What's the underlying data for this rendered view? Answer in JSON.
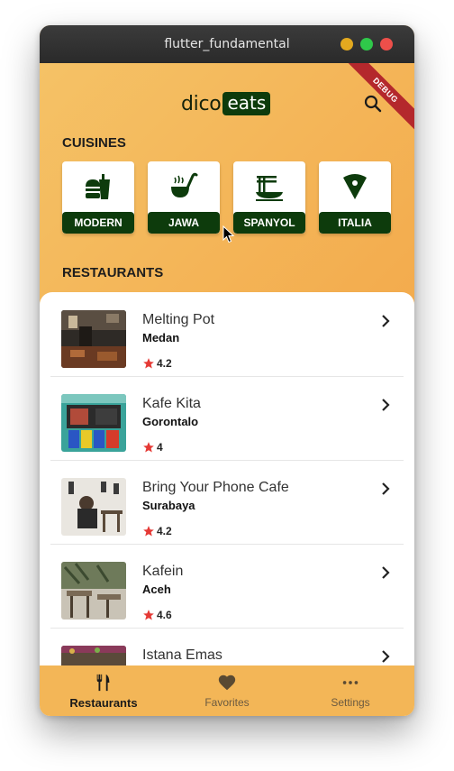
{
  "window": {
    "title": "flutter_fundamental"
  },
  "debug_banner": "DEBUG",
  "logo": {
    "part1": "dico",
    "part2": "eats"
  },
  "sections": {
    "cuisines": "CUISINES",
    "restaurants": "RESTAURANTS"
  },
  "cuisines": [
    {
      "label": "MODERN",
      "icon": "burger-drink-icon"
    },
    {
      "label": "JAWA",
      "icon": "soup-ladle-icon"
    },
    {
      "label": "SPANYOL",
      "icon": "noodle-bowl-icon"
    },
    {
      "label": "ITALIA",
      "icon": "pizza-slice-icon"
    }
  ],
  "restaurants": [
    {
      "name": "Melting Pot",
      "city": "Medan",
      "rating": "4.2"
    },
    {
      "name": "Kafe Kita",
      "city": "Gorontalo",
      "rating": "4"
    },
    {
      "name": "Bring Your Phone Cafe",
      "city": "Surabaya",
      "rating": "4.2"
    },
    {
      "name": "Kafein",
      "city": "Aceh",
      "rating": "4.6"
    },
    {
      "name": "Istana Emas",
      "city": "",
      "rating": ""
    }
  ],
  "nav": [
    {
      "label": "Restaurants",
      "icon": "fork-knife-icon",
      "active": true
    },
    {
      "label": "Favorites",
      "icon": "heart-icon",
      "active": false
    },
    {
      "label": "Settings",
      "icon": "more-horizontal-icon",
      "active": false
    }
  ],
  "colors": {
    "primary": "#0d3b0c",
    "accent": "#f3b257",
    "star": "#e53935"
  }
}
